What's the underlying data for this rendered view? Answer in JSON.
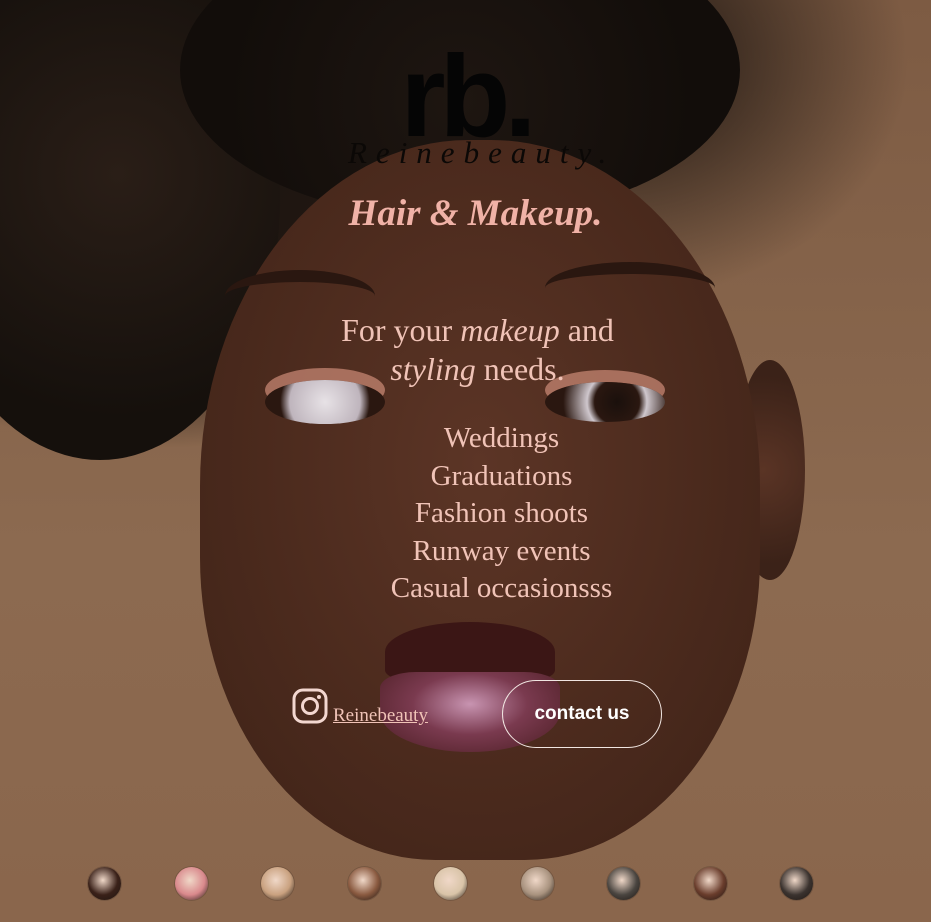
{
  "brand": {
    "logo": "rb.",
    "name": "Reinebeauty.",
    "tagline": "Hair & Makeup."
  },
  "intro": {
    "line1_a": "For your ",
    "line1_em": "makeup",
    "line1_b": " and",
    "line2_em": "styling",
    "line2_b": " needs."
  },
  "services": [
    "Weddings",
    "Graduations",
    "Fashion shoots",
    "Runway events",
    "Casual occasionsss"
  ],
  "social": {
    "icon": "instagram-icon",
    "handle": " Reinebeauty "
  },
  "cta": {
    "label": "contact us"
  },
  "colors": {
    "accent_pink": "#f0b2a7",
    "text_light": "#f0c3b7",
    "button_border": "#f1e6e2",
    "logo_black": "#050505"
  },
  "gallery": [
    {
      "name": "gallery-thumb-1",
      "color": "#3a2119"
    },
    {
      "name": "gallery-thumb-2",
      "color": "#d9898c"
    },
    {
      "name": "gallery-thumb-3",
      "color": "#c9a17f"
    },
    {
      "name": "gallery-thumb-4",
      "color": "#8a5a40"
    },
    {
      "name": "gallery-thumb-5",
      "color": "#d9c4a8"
    },
    {
      "name": "gallery-thumb-6",
      "color": "#a8927e"
    },
    {
      "name": "gallery-thumb-7",
      "color": "#4a4540"
    },
    {
      "name": "gallery-thumb-8",
      "color": "#6a3d2c"
    },
    {
      "name": "gallery-thumb-9",
      "color": "#3b332f"
    }
  ]
}
